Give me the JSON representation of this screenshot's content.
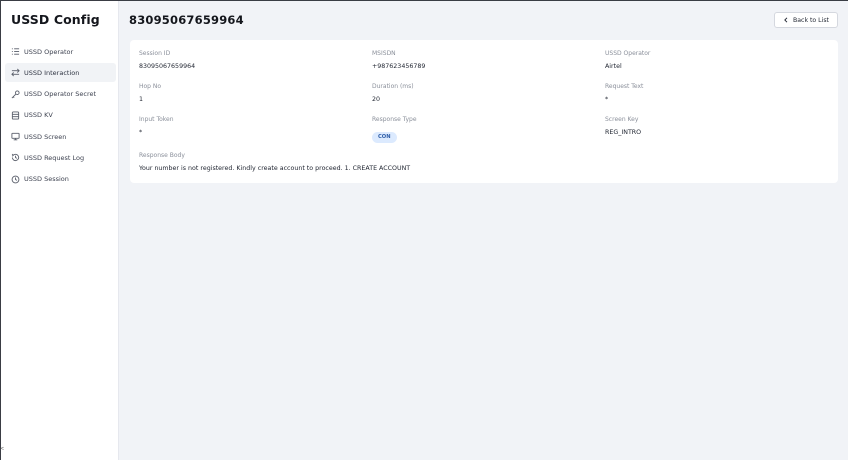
{
  "app": {
    "title": "USSD Config"
  },
  "sidebar": {
    "items": [
      {
        "label": "USSD Operator",
        "icon": "list-icon"
      },
      {
        "label": "USSD Interaction",
        "icon": "arrows-swap-icon"
      },
      {
        "label": "USSD Operator Secret",
        "icon": "key-icon"
      },
      {
        "label": "USSD KV",
        "icon": "database-icon"
      },
      {
        "label": "USSD Screen",
        "icon": "monitor-icon"
      },
      {
        "label": "USSD Request Log",
        "icon": "history-icon"
      },
      {
        "label": "USSD Session",
        "icon": "clock-icon"
      }
    ],
    "active_index": 1,
    "corner_glyph": "<"
  },
  "header": {
    "title": "83095067659964",
    "back_label": "Back to List"
  },
  "details": {
    "session_id": {
      "label": "Session ID",
      "value": "83095067659964"
    },
    "msisdn": {
      "label": "MSISDN",
      "value": "+987623456789"
    },
    "ussd_operator": {
      "label": "USSD Operator",
      "value": "Airtel"
    },
    "hop_no": {
      "label": "Hop No",
      "value": "1"
    },
    "duration": {
      "label": "Duration (ms)",
      "value": "20"
    },
    "request_text": {
      "label": "Request Text",
      "value": "*"
    },
    "input_token": {
      "label": "Input Token",
      "value": "*"
    },
    "response_type": {
      "label": "Response Type",
      "value": "CON"
    },
    "screen_key": {
      "label": "Screen Key",
      "value": "REG_INTRO"
    },
    "response_body": {
      "label": "Response Body",
      "value": "Your number is not registered. Kindly create account to proceed. 1. CREATE ACCOUNT"
    }
  },
  "colors": {
    "background": "#f1f3f7",
    "badge_bg": "#dceafe",
    "badge_text": "#2f5ea8"
  }
}
